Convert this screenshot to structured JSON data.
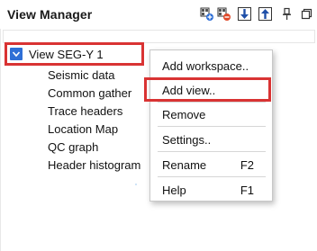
{
  "panel": {
    "title": "View Manager",
    "toolbar": [
      {
        "icon": "add-view-icon"
      },
      {
        "icon": "remove-view-icon"
      },
      {
        "icon": "move-down-icon"
      },
      {
        "icon": "move-up-icon"
      },
      {
        "icon": "pin-icon"
      },
      {
        "icon": "restore-window-icon"
      }
    ]
  },
  "tree": {
    "root_label": "View SEG-Y 1",
    "items": [
      "Seismic data",
      "Common gather",
      "Trace headers",
      "Location Map",
      "QC graph",
      "Header histogram"
    ]
  },
  "context_menu": {
    "items": [
      {
        "label": "Add workspace..",
        "shortcut": ""
      },
      {
        "label": "Add view..",
        "shortcut": ""
      },
      {
        "label": "Remove",
        "shortcut": ""
      },
      {
        "label": "Settings..",
        "shortcut": ""
      },
      {
        "label": "Rename",
        "shortcut": "F2"
      },
      {
        "label": "Help",
        "shortcut": "F1"
      }
    ]
  },
  "colors": {
    "highlight": "#d93333",
    "accent": "#2f6fd6"
  }
}
